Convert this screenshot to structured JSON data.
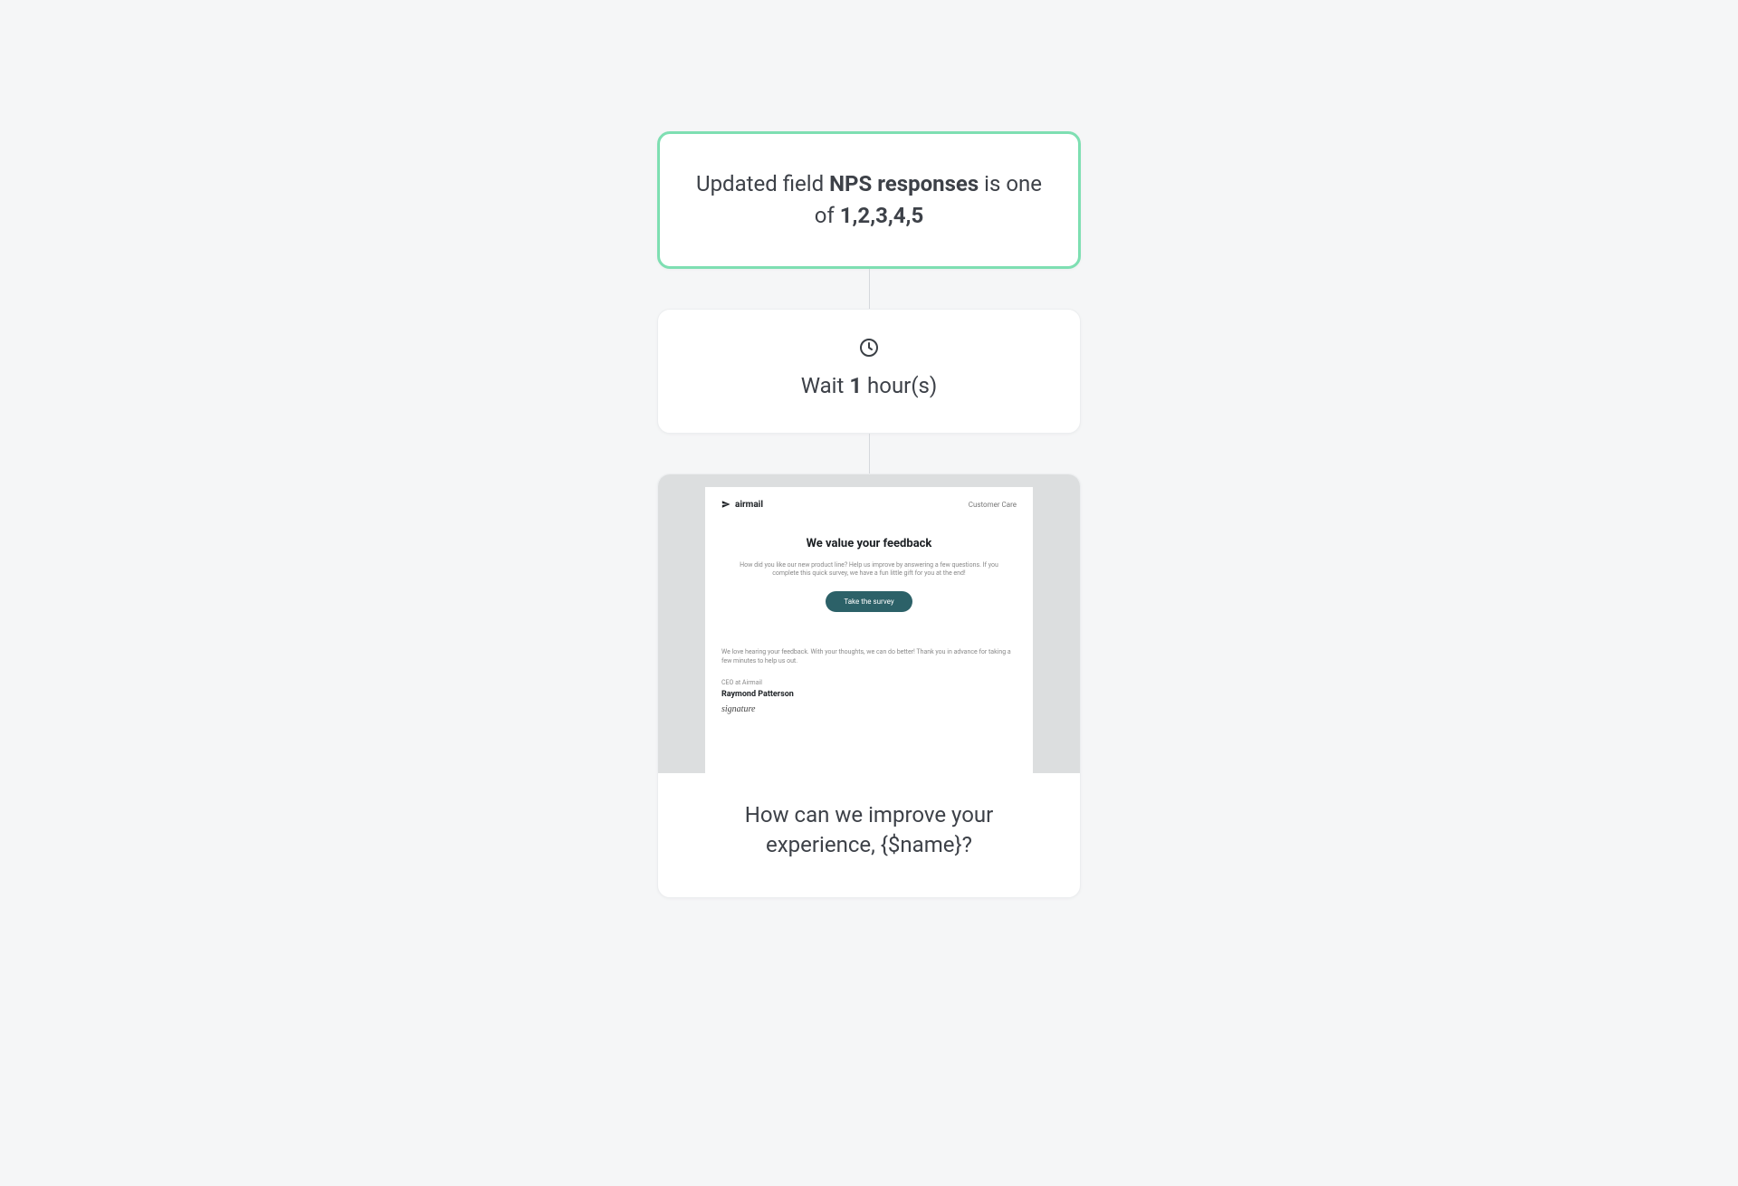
{
  "trigger": {
    "prefix": "Updated field ",
    "field_name": "NPS responses",
    "condition": " is one of ",
    "values": "1,2,3,4,5"
  },
  "wait": {
    "prefix": "Wait ",
    "amount": "1",
    "unit": " hour(s)"
  },
  "email": {
    "brand": "airmail",
    "customer_care": "Customer Care",
    "heading": "We value your feedback",
    "intro": "How did you like our new product line? Help us improve by answering a few questions. If you complete this quick survey, we have a fun little gift for you at the end!",
    "button": "Take the survey",
    "note": "We love hearing your feedback. With your thoughts, we can do better! Thank you in advance for taking a few minutes to help us out.",
    "role": "CEO at Airmail",
    "name": "Raymond Patterson",
    "signature": "signature",
    "title": "How can we improve your experience, {$name}?"
  }
}
